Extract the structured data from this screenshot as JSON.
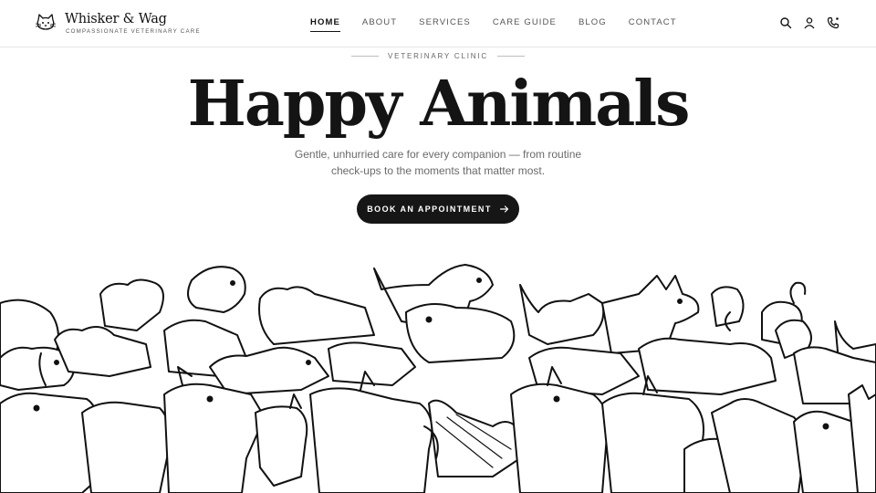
{
  "brand": {
    "name": "Whisker & Wag",
    "tagline": "COMPASSIONATE VETERINARY CARE",
    "logo_icon": "cat-face-icon"
  },
  "nav": {
    "items": [
      {
        "label": "HOME",
        "active": true
      },
      {
        "label": "ABOUT",
        "active": false
      },
      {
        "label": "SERVICES",
        "active": false
      },
      {
        "label": "CARE GUIDE",
        "active": false
      },
      {
        "label": "BLOG",
        "active": false
      },
      {
        "label": "CONTACT",
        "active": false
      }
    ]
  },
  "header_icons": [
    "search-icon",
    "user-icon",
    "phone-icon"
  ],
  "hero": {
    "eyebrow": "VETERINARY CLINIC",
    "title": "Happy Animals",
    "subtitle_line1": "Gentle, unhurried care for every companion — from routine",
    "subtitle_line2": "check-ups to the moments that matter most.",
    "cta_label": "BOOK AN APPOINTMENT",
    "cta_icon": "arrow-right-icon"
  },
  "illustration": {
    "subject": "line-art-crowd-of-animals"
  },
  "colors": {
    "text": "#161616",
    "muted": "#6a6a6a",
    "button_bg": "#161616",
    "button_text": "#ffffff",
    "background": "#ffffff"
  }
}
